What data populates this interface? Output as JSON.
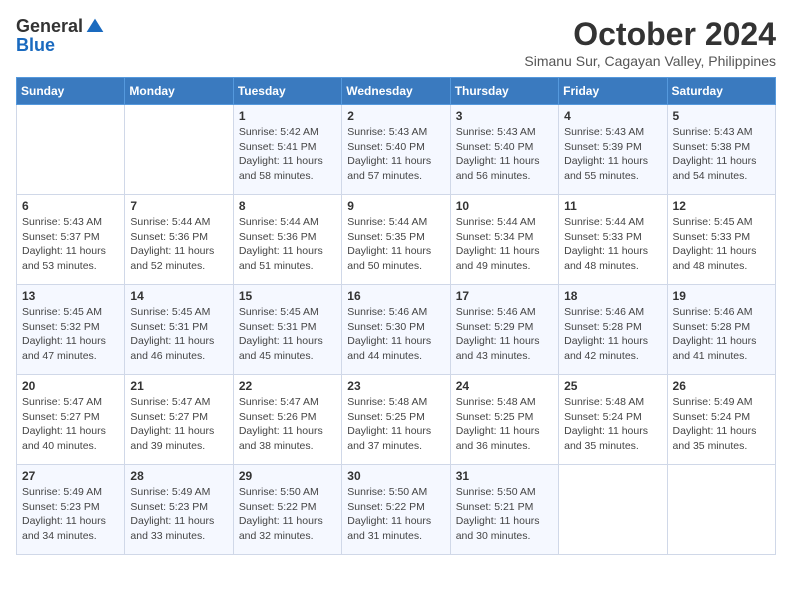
{
  "logo": {
    "general": "General",
    "blue": "Blue"
  },
  "title": "October 2024",
  "subtitle": "Simanu Sur, Cagayan Valley, Philippines",
  "headers": [
    "Sunday",
    "Monday",
    "Tuesday",
    "Wednesday",
    "Thursday",
    "Friday",
    "Saturday"
  ],
  "weeks": [
    [
      {
        "day": "",
        "info": ""
      },
      {
        "day": "",
        "info": ""
      },
      {
        "day": "1",
        "info": "Sunrise: 5:42 AM\nSunset: 5:41 PM\nDaylight: 11 hours and 58 minutes."
      },
      {
        "day": "2",
        "info": "Sunrise: 5:43 AM\nSunset: 5:40 PM\nDaylight: 11 hours and 57 minutes."
      },
      {
        "day": "3",
        "info": "Sunrise: 5:43 AM\nSunset: 5:40 PM\nDaylight: 11 hours and 56 minutes."
      },
      {
        "day": "4",
        "info": "Sunrise: 5:43 AM\nSunset: 5:39 PM\nDaylight: 11 hours and 55 minutes."
      },
      {
        "day": "5",
        "info": "Sunrise: 5:43 AM\nSunset: 5:38 PM\nDaylight: 11 hours and 54 minutes."
      }
    ],
    [
      {
        "day": "6",
        "info": "Sunrise: 5:43 AM\nSunset: 5:37 PM\nDaylight: 11 hours and 53 minutes."
      },
      {
        "day": "7",
        "info": "Sunrise: 5:44 AM\nSunset: 5:36 PM\nDaylight: 11 hours and 52 minutes."
      },
      {
        "day": "8",
        "info": "Sunrise: 5:44 AM\nSunset: 5:36 PM\nDaylight: 11 hours and 51 minutes."
      },
      {
        "day": "9",
        "info": "Sunrise: 5:44 AM\nSunset: 5:35 PM\nDaylight: 11 hours and 50 minutes."
      },
      {
        "day": "10",
        "info": "Sunrise: 5:44 AM\nSunset: 5:34 PM\nDaylight: 11 hours and 49 minutes."
      },
      {
        "day": "11",
        "info": "Sunrise: 5:44 AM\nSunset: 5:33 PM\nDaylight: 11 hours and 48 minutes."
      },
      {
        "day": "12",
        "info": "Sunrise: 5:45 AM\nSunset: 5:33 PM\nDaylight: 11 hours and 48 minutes."
      }
    ],
    [
      {
        "day": "13",
        "info": "Sunrise: 5:45 AM\nSunset: 5:32 PM\nDaylight: 11 hours and 47 minutes."
      },
      {
        "day": "14",
        "info": "Sunrise: 5:45 AM\nSunset: 5:31 PM\nDaylight: 11 hours and 46 minutes."
      },
      {
        "day": "15",
        "info": "Sunrise: 5:45 AM\nSunset: 5:31 PM\nDaylight: 11 hours and 45 minutes."
      },
      {
        "day": "16",
        "info": "Sunrise: 5:46 AM\nSunset: 5:30 PM\nDaylight: 11 hours and 44 minutes."
      },
      {
        "day": "17",
        "info": "Sunrise: 5:46 AM\nSunset: 5:29 PM\nDaylight: 11 hours and 43 minutes."
      },
      {
        "day": "18",
        "info": "Sunrise: 5:46 AM\nSunset: 5:28 PM\nDaylight: 11 hours and 42 minutes."
      },
      {
        "day": "19",
        "info": "Sunrise: 5:46 AM\nSunset: 5:28 PM\nDaylight: 11 hours and 41 minutes."
      }
    ],
    [
      {
        "day": "20",
        "info": "Sunrise: 5:47 AM\nSunset: 5:27 PM\nDaylight: 11 hours and 40 minutes."
      },
      {
        "day": "21",
        "info": "Sunrise: 5:47 AM\nSunset: 5:27 PM\nDaylight: 11 hours and 39 minutes."
      },
      {
        "day": "22",
        "info": "Sunrise: 5:47 AM\nSunset: 5:26 PM\nDaylight: 11 hours and 38 minutes."
      },
      {
        "day": "23",
        "info": "Sunrise: 5:48 AM\nSunset: 5:25 PM\nDaylight: 11 hours and 37 minutes."
      },
      {
        "day": "24",
        "info": "Sunrise: 5:48 AM\nSunset: 5:25 PM\nDaylight: 11 hours and 36 minutes."
      },
      {
        "day": "25",
        "info": "Sunrise: 5:48 AM\nSunset: 5:24 PM\nDaylight: 11 hours and 35 minutes."
      },
      {
        "day": "26",
        "info": "Sunrise: 5:49 AM\nSunset: 5:24 PM\nDaylight: 11 hours and 35 minutes."
      }
    ],
    [
      {
        "day": "27",
        "info": "Sunrise: 5:49 AM\nSunset: 5:23 PM\nDaylight: 11 hours and 34 minutes."
      },
      {
        "day": "28",
        "info": "Sunrise: 5:49 AM\nSunset: 5:23 PM\nDaylight: 11 hours and 33 minutes."
      },
      {
        "day": "29",
        "info": "Sunrise: 5:50 AM\nSunset: 5:22 PM\nDaylight: 11 hours and 32 minutes."
      },
      {
        "day": "30",
        "info": "Sunrise: 5:50 AM\nSunset: 5:22 PM\nDaylight: 11 hours and 31 minutes."
      },
      {
        "day": "31",
        "info": "Sunrise: 5:50 AM\nSunset: 5:21 PM\nDaylight: 11 hours and 30 minutes."
      },
      {
        "day": "",
        "info": ""
      },
      {
        "day": "",
        "info": ""
      }
    ]
  ]
}
